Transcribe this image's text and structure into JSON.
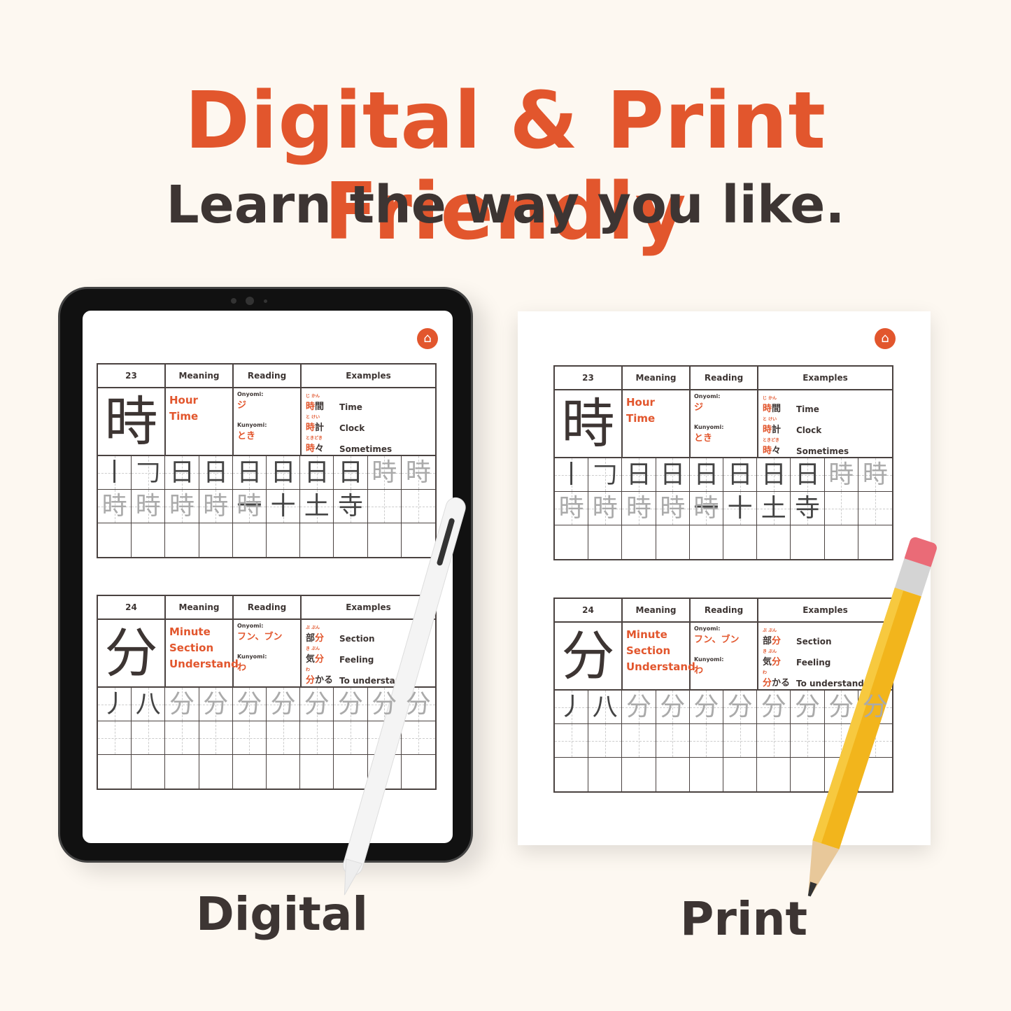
{
  "header": {
    "title": "Digital & Print Friendly",
    "subtitle": "Learn the way you like."
  },
  "labels": {
    "digital": "Digital",
    "print": "Print"
  },
  "colors": {
    "accent": "#e2562d",
    "text": "#3d3533",
    "background": "#fdf8f1"
  },
  "home_icon": "home-icon",
  "worksheets": [
    {
      "number": "23",
      "kanji": "時",
      "meaning_header": "Meaning",
      "reading_header": "Reading",
      "examples_header": "Examples",
      "meanings": [
        "Hour",
        "Time"
      ],
      "onyomi_label": "Onyomi:",
      "onyomi": "ジ",
      "kunyomi_label": "Kunyomi:",
      "kunyomi": "とき",
      "examples": [
        {
          "furigana": "じ かん",
          "word": "時間",
          "highlight": "時",
          "rest": "間",
          "english": "Time"
        },
        {
          "furigana": "と けい",
          "word": "時計",
          "highlight": "時",
          "rest": "計",
          "english": "Clock"
        },
        {
          "furigana": "ときどき",
          "word": "時々",
          "highlight": "時",
          "rest": "々",
          "english": "Sometimes"
        }
      ],
      "stroke_steps": [
        "丨",
        "𠃌",
        "日",
        "日",
        "日一",
        "日十",
        "日土",
        "日寺",
        "時",
        "時"
      ]
    },
    {
      "number": "24",
      "kanji": "分",
      "meaning_header": "Meaning",
      "reading_header": "Reading",
      "examples_header": "Examples",
      "meanings": [
        "Minute",
        "Section",
        "Understand"
      ],
      "onyomi_label": "Onyomi:",
      "onyomi": "フン、ブン",
      "kunyomi_label": "Kunyomi:",
      "kunyomi": "わ",
      "examples": [
        {
          "furigana": "ぶ ぶん",
          "word": "部分",
          "highlight": "分",
          "rest": "部",
          "english": "Section",
          "pre": true
        },
        {
          "furigana": "き ぶん",
          "word": "気分",
          "highlight": "分",
          "rest": "気",
          "english": "Feeling",
          "pre": true
        },
        {
          "furigana": "わ",
          "word": "分かる",
          "highlight": "分",
          "rest": "かる",
          "english": "To understand"
        }
      ],
      "stroke_steps": [
        "丿",
        "八",
        "分",
        "分"
      ]
    }
  ]
}
